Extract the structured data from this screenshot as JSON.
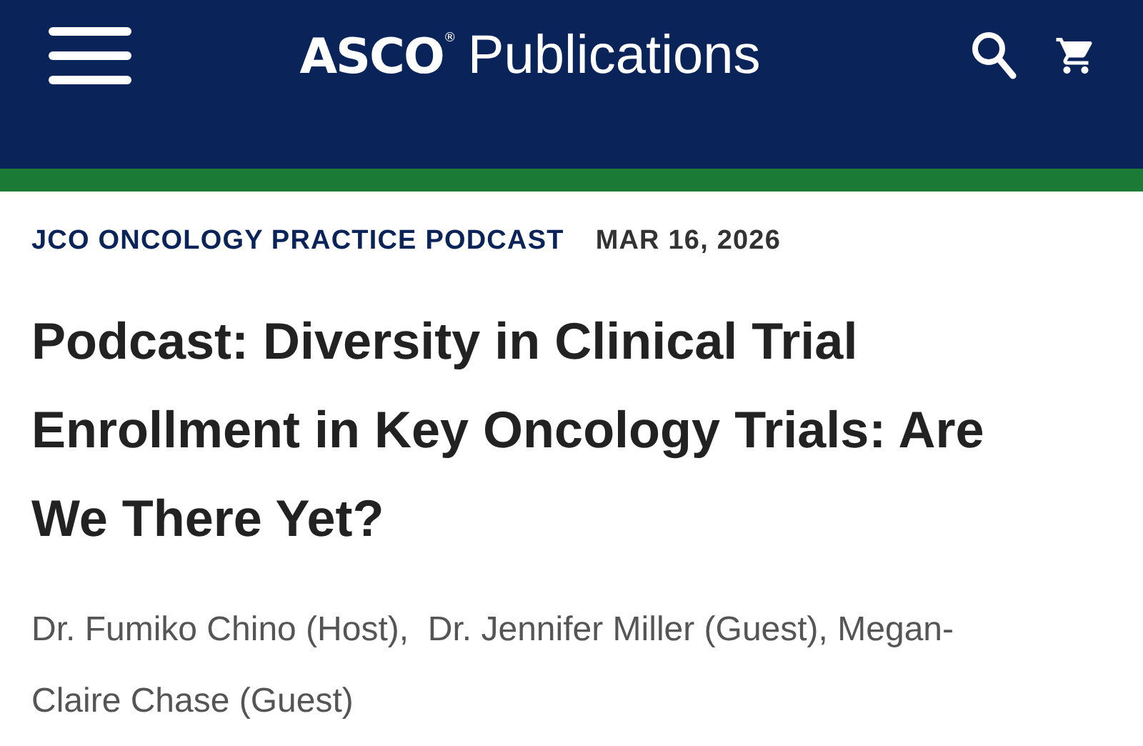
{
  "header": {
    "logo": {
      "brand": "ASCO",
      "mark": "®",
      "name": "Publications"
    }
  },
  "article": {
    "section": "JCO ONCOLOGY PRACTICE PODCAST",
    "date": "MAR 16, 2026",
    "title": "Podcast: Diversity in Clinical Trial Enrollment in Key Oncology Trials: Are We There Yet?",
    "authors": "Dr. Fumiko Chino (Host),  Dr. Jennifer Miller (Guest), Megan-Claire Chase (Guest)"
  }
}
